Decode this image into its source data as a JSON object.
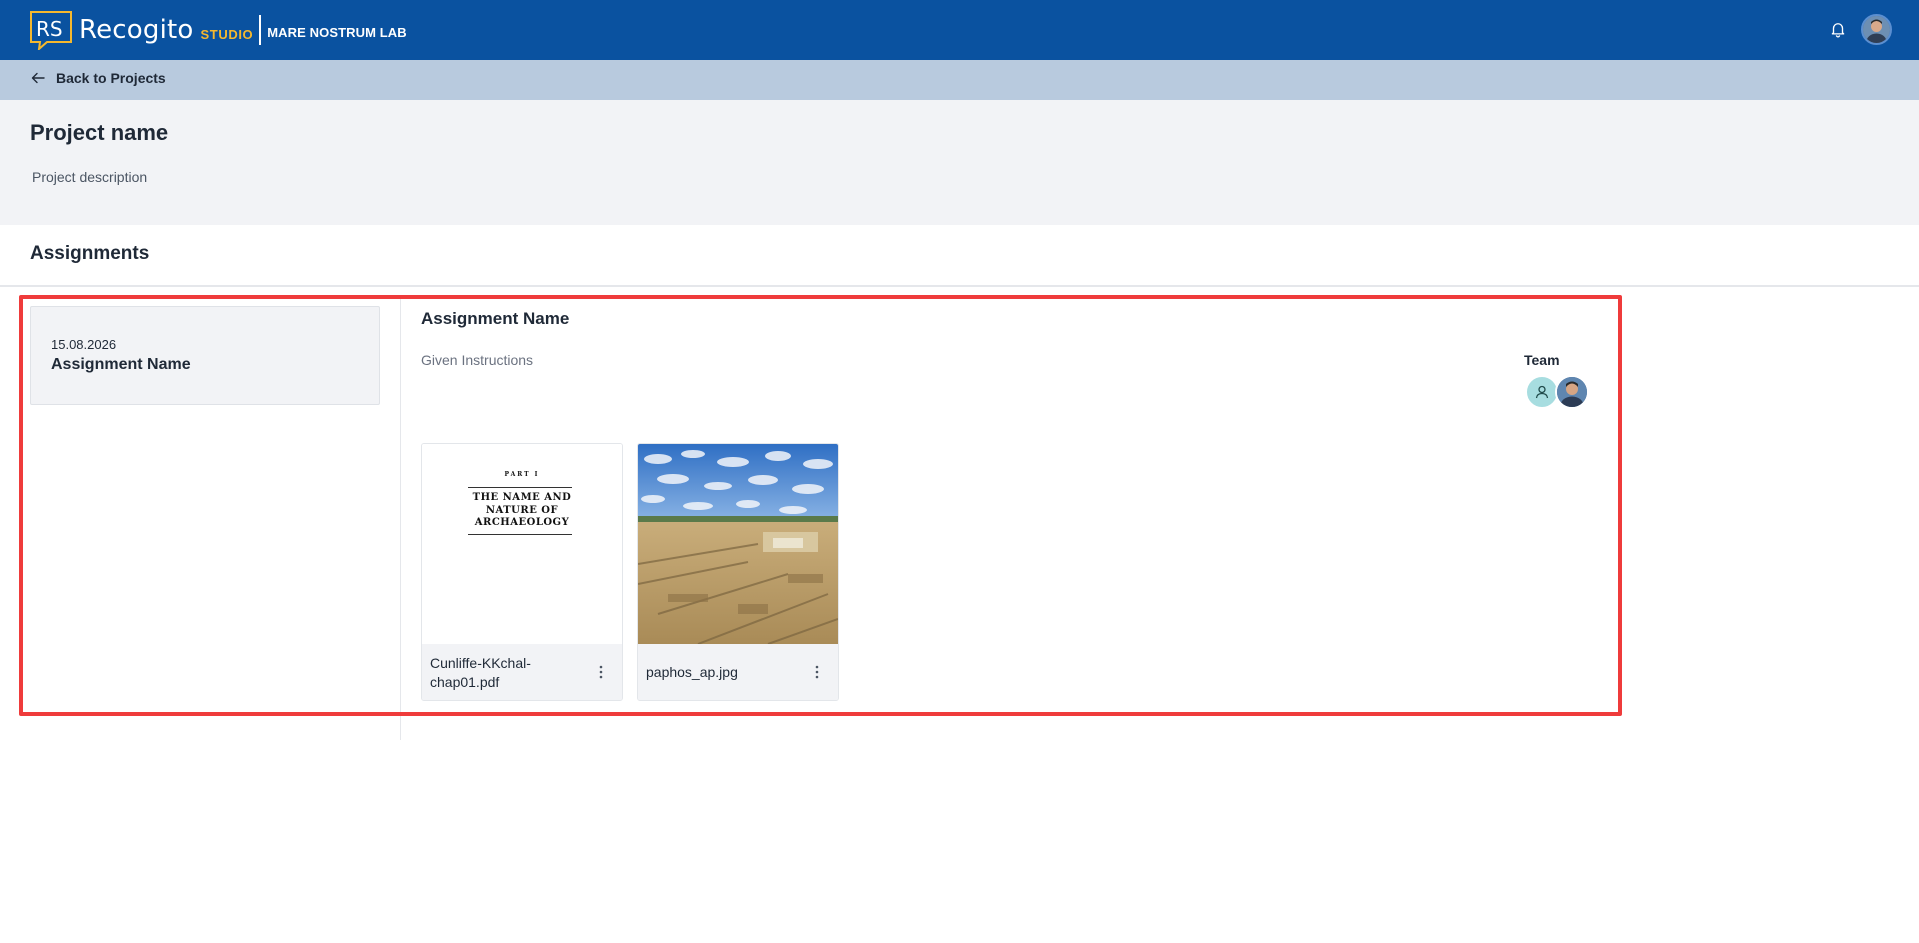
{
  "header": {
    "logo_letters": "RS",
    "logo_word": "Recogito",
    "logo_studio": "STUDIO",
    "org_name": "MARE NOSTRUM LAB",
    "notification_icon": "bell-icon",
    "colors": {
      "bar": "#0a52a0",
      "accent": "#f5b82e"
    }
  },
  "nav": {
    "back_label": "Back to Projects",
    "back_icon": "arrow-left-icon"
  },
  "project": {
    "title": "Project name",
    "description": "Project description"
  },
  "assignments": {
    "heading": "Assignments",
    "list": [
      {
        "date": "15.08.2026",
        "name": "Assignment Name"
      }
    ],
    "detail": {
      "name": "Assignment Name",
      "instructions": "Given Instructions",
      "team_label": "Team",
      "documents": [
        {
          "name": "Cunliffe-KKchal-chap01.pdf",
          "thumb_part": "PART I",
          "thumb_title": "THE NAME AND NATURE OF ARCHAEOLOGY"
        },
        {
          "name": "paphos_ap.jpg"
        }
      ]
    }
  },
  "highlight_color": "#ef3b3b"
}
